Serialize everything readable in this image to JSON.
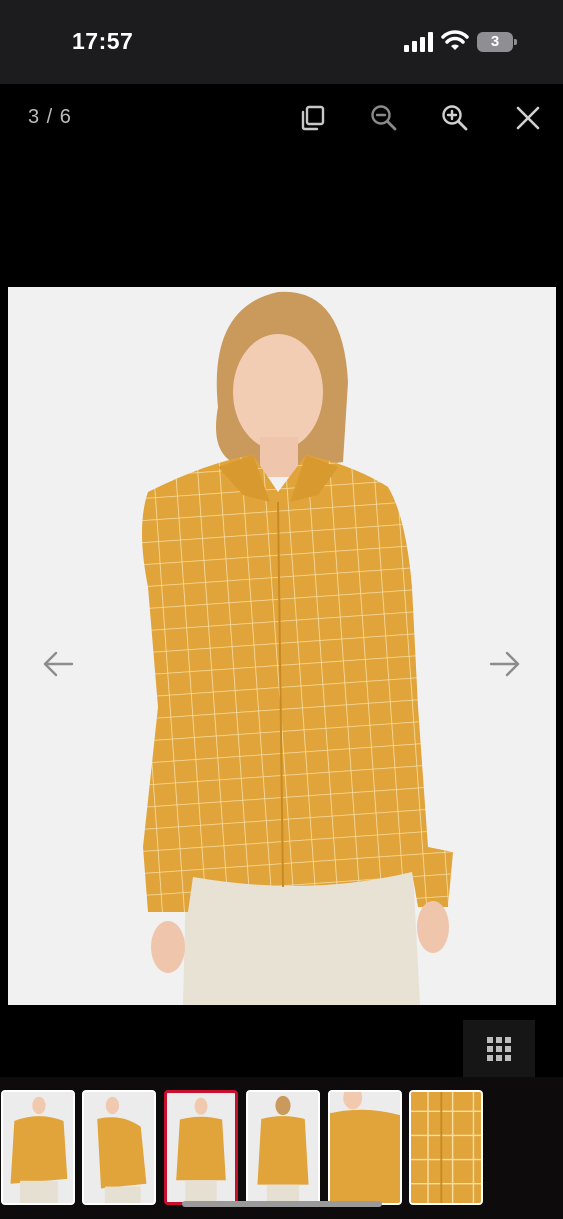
{
  "status_bar": {
    "time": "17:57",
    "battery_level": "3",
    "icons": [
      "signal-icon",
      "wifi-icon",
      "battery-icon"
    ]
  },
  "viewer": {
    "counter": "3 / 6",
    "toolbar": {
      "buttons": [
        "copy-icon",
        "zoom-out-icon",
        "zoom-in-icon",
        "close-icon"
      ]
    },
    "navigation": {
      "prev": "arrow-left-icon",
      "next": "arrow-right-icon"
    },
    "grid_button_icon": "grid-icon",
    "current_index": 3,
    "total": 6
  },
  "colors": {
    "shirt": "#e0a43a",
    "accent_active": "#c8102e",
    "status_bar_bg": "#1c1c1e",
    "background": "#000000"
  },
  "thumbnails": [
    {
      "selected": false
    },
    {
      "selected": false
    },
    {
      "selected": true
    },
    {
      "selected": false
    },
    {
      "selected": false
    },
    {
      "selected": false
    }
  ]
}
